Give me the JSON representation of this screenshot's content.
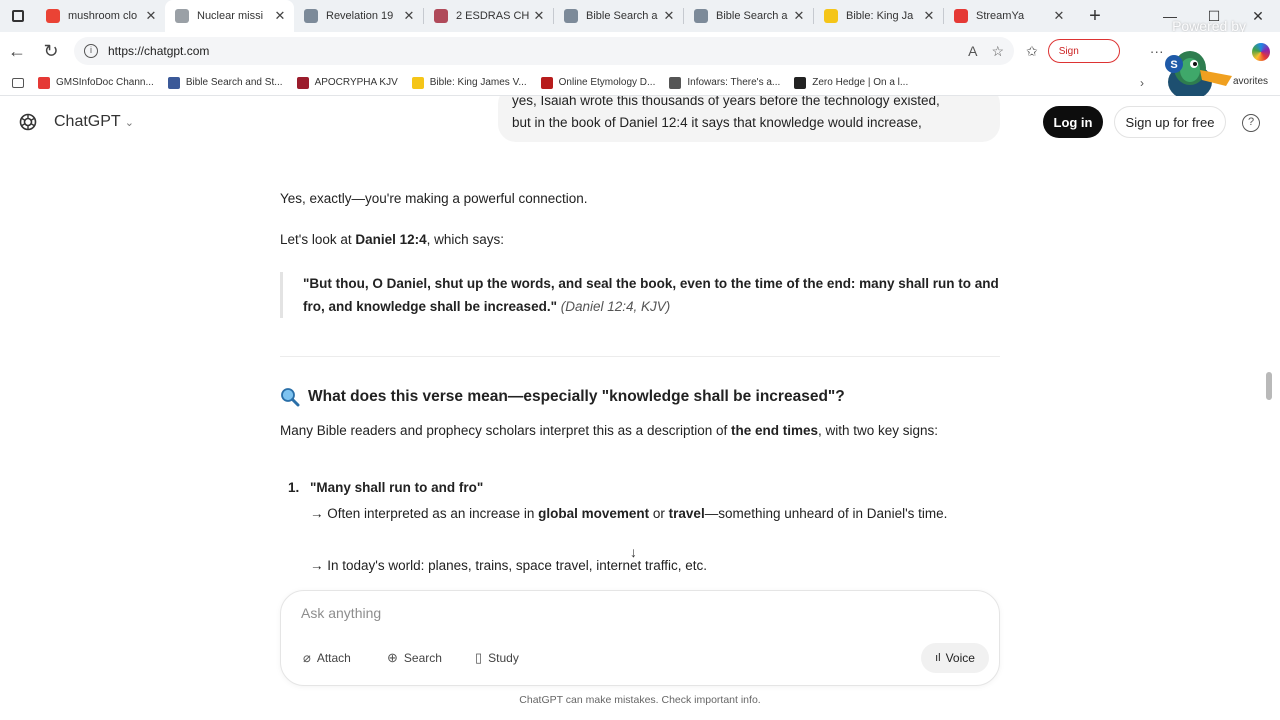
{
  "browser": {
    "tabs": [
      {
        "title": "mushroom clo",
        "color": "#ea4335"
      },
      {
        "title": "Nuclear missi",
        "color": "#9aa0a6",
        "active": true
      },
      {
        "title": "Revelation 19",
        "color": "#7c8a99"
      },
      {
        "title": "2 ESDRAS CH",
        "color": "#b04a5a"
      },
      {
        "title": "Bible Search a",
        "color": "#7c8a99"
      },
      {
        "title": "Bible Search a",
        "color": "#7c8a99"
      },
      {
        "title": "Bible: King Ja",
        "color": "#f5c518"
      },
      {
        "title": "StreamYa",
        "color": "#e53935"
      }
    ],
    "close_glyph": "✕",
    "new_tab_glyph": "+",
    "powered_by": "Powered by",
    "url": "https://chatgpt.com",
    "signin_label": "Sign",
    "bookmarks": [
      {
        "label": "GMSInfoDoc Chann...",
        "color": "#e53935"
      },
      {
        "label": "Bible Search and St...",
        "color": "#3b5998"
      },
      {
        "label": "APOCRYPHA KJV",
        "color": "#9b1c2c"
      },
      {
        "label": "Bible: King James V...",
        "color": "#f5c518"
      },
      {
        "label": "Online Etymology D...",
        "color": "#b71c1c"
      },
      {
        "label": "Infowars: There's a...",
        "color": "#555555"
      },
      {
        "label": "Zero Hedge | On a l...",
        "color": "#222222"
      }
    ],
    "bookmarks_overflow": "avorites"
  },
  "chatgpt": {
    "app_name": "ChatGPT",
    "login_label": "Log in",
    "signup_label": "Sign up for free",
    "user_message_line1": "yes, Isaiah wrote this thousands of years before the technology existed,",
    "user_message_line2": "but in the book of Daniel 12:4 it says that knowledge would increase,",
    "answer": {
      "p1": "Yes, exactly—you're making a powerful connection.",
      "p2_prefix": "Let's look at ",
      "p2_bold": "Daniel 12:4",
      "p2_suffix": ", which says:",
      "quote": "\"But thou, O Daniel, shut up the words, and seal the book, even to the time of the end: many shall run to and fro, and knowledge shall be increased.\"",
      "quote_ref": "(Daniel 12:4, KJV)",
      "heading": "What does this verse mean—especially \"knowledge shall be increased\"?",
      "intro_prefix": "Many Bible readers and prophecy scholars interpret this as a description of ",
      "intro_bold": "the end times",
      "intro_suffix": ", with two key signs:",
      "item1_num": "1.",
      "item1_title": "\"Many shall run to and fro\"",
      "item1_sub1_prefix": "→ Often interpreted as an increase in ",
      "item1_sub1_bold1": "global movement",
      "item1_sub1_mid": " or ",
      "item1_sub1_bold2": "travel",
      "item1_sub1_suffix": "—something unheard of in Daniel's time.",
      "item1_sub2": "→ In today's world: planes, trains, space travel, internet traffic, etc."
    },
    "composer": {
      "placeholder": "Ask anything",
      "attach_label": "Attach",
      "search_label": "Search",
      "study_label": "Study",
      "voice_label": "Voice"
    },
    "disclaimer": "ChatGPT can make mistakes. Check important info."
  }
}
